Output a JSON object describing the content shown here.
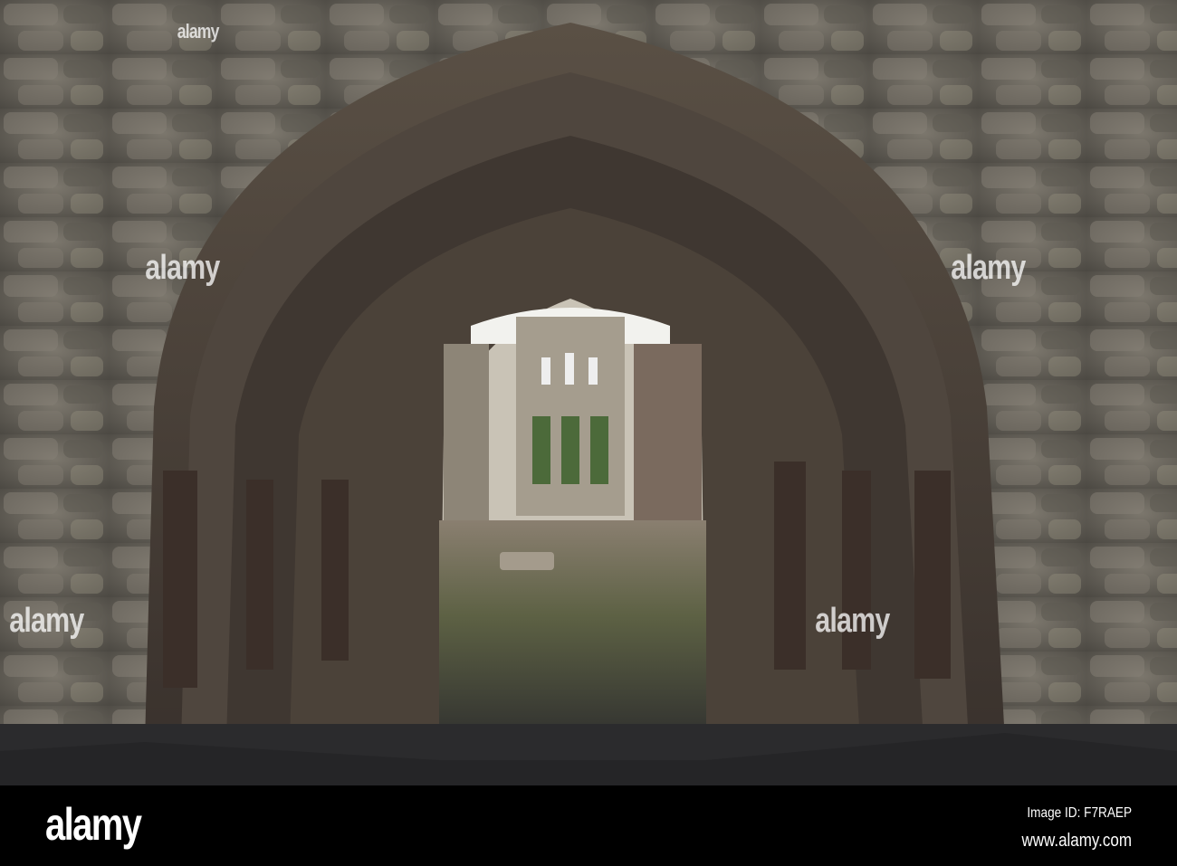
{
  "photo": {
    "subject": "Gothic stone arch doorway into roofless ruined church",
    "colors": {
      "wall": "#6e6a62",
      "arch": "#4a3e36",
      "interior": "#c9c3b6",
      "sky": "#f2f2ee",
      "gravel": "#2a2a2c"
    }
  },
  "watermark": {
    "text": "alamy"
  },
  "footer": {
    "logo": "alamy",
    "image_id": "Image ID: F7RAEP",
    "site": "www.alamy.com"
  }
}
